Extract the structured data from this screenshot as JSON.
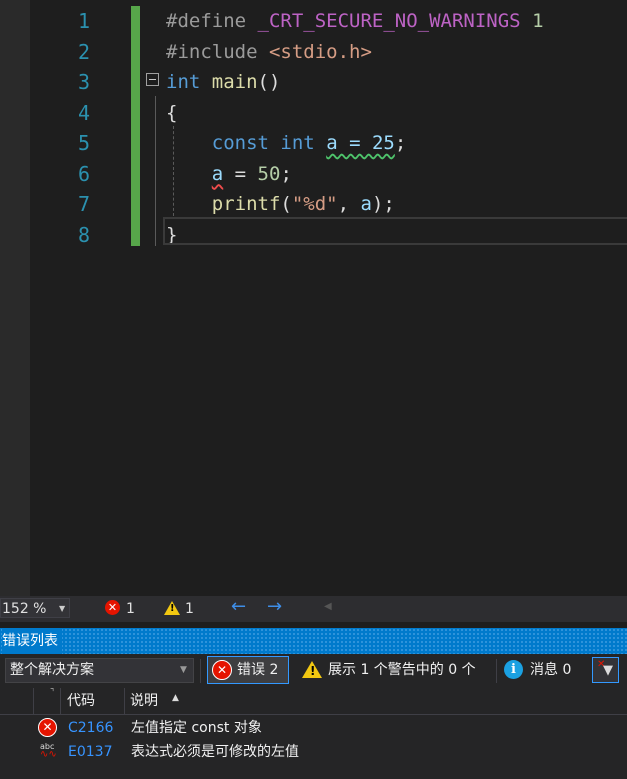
{
  "editor": {
    "line_numbers": [
      "1",
      "2",
      "3",
      "4",
      "5",
      "6",
      "7",
      "8"
    ],
    "lines": [
      {
        "parts": [
          {
            "t": "#define ",
            "c": "pp"
          },
          {
            "t": "_CRT_SECURE_NO_WARNINGS",
            "c": "macro"
          },
          {
            "t": " 1",
            "c": "num"
          }
        ]
      },
      {
        "parts": [
          {
            "t": "#include ",
            "c": "pp"
          },
          {
            "t": "<stdio.h>",
            "c": "str"
          }
        ]
      },
      {
        "parts": [
          {
            "t": "int",
            "c": "kw"
          },
          {
            "t": " ",
            "c": ""
          },
          {
            "t": "main",
            "c": "fn"
          },
          {
            "t": "()",
            "c": ""
          }
        ]
      },
      {
        "parts": [
          {
            "t": "{",
            "c": ""
          }
        ]
      },
      {
        "parts": [
          {
            "t": "    ",
            "c": ""
          },
          {
            "t": "const",
            "c": "kw"
          },
          {
            "t": " ",
            "c": ""
          },
          {
            "t": "int",
            "c": "kw"
          },
          {
            "t": " ",
            "c": ""
          },
          {
            "t": "a = 25",
            "c": "var squig-green"
          },
          {
            "t": ";",
            "c": ""
          }
        ]
      },
      {
        "parts": [
          {
            "t": "    ",
            "c": ""
          },
          {
            "t": "a",
            "c": "var squig-red"
          },
          {
            "t": " = ",
            "c": ""
          },
          {
            "t": "50",
            "c": "num"
          },
          {
            "t": ";",
            "c": ""
          }
        ]
      },
      {
        "parts": [
          {
            "t": "    ",
            "c": ""
          },
          {
            "t": "printf",
            "c": "fn"
          },
          {
            "t": "(",
            "c": ""
          },
          {
            "t": "\"%d\"",
            "c": "str"
          },
          {
            "t": ", ",
            "c": ""
          },
          {
            "t": "a",
            "c": "var"
          },
          {
            "t": ");",
            "c": ""
          }
        ]
      },
      {
        "parts": [
          {
            "t": "}",
            "c": ""
          }
        ]
      }
    ]
  },
  "status_bar": {
    "zoom": "152 %",
    "error_count": "1",
    "warning_count": "1"
  },
  "error_list": {
    "title": "错误列表",
    "scope": "整个解决方案",
    "errors_button": "错误 2",
    "warnings_button": "展示 1 个警告中的 0 个",
    "messages_button": "消息 0",
    "columns": {
      "code": "代码",
      "description": "说明"
    },
    "rows": [
      {
        "code": "C2166",
        "description": "左值指定 const 对象",
        "kind": "error-icon"
      },
      {
        "code": "E0137",
        "description": "表达式必须是可修改的左值",
        "kind": "spell-error-icon"
      }
    ]
  },
  "colors": {
    "accent": "#007acc",
    "error": "#e51400",
    "warning": "#f2c811",
    "link": "#3794ff"
  }
}
